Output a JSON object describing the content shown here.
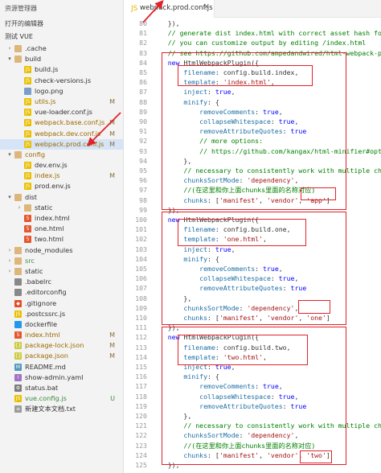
{
  "sidebar": {
    "title": "资源管理器",
    "open_editors": "打开的编辑器",
    "project": "测试 VUE",
    "items": [
      {
        "name": ".cache",
        "depth": 0,
        "kind": "folder",
        "open": false,
        "icon": "folder-icon",
        "badge": ""
      },
      {
        "name": "build",
        "depth": 0,
        "kind": "folder",
        "open": true,
        "icon": "folder-icon",
        "badge": ""
      },
      {
        "name": "build.js",
        "depth": 1,
        "kind": "js",
        "icon": "js-file-icon",
        "badge": ""
      },
      {
        "name": "check-versions.js",
        "depth": 1,
        "kind": "js",
        "icon": "js-file-icon",
        "badge": ""
      },
      {
        "name": "logo.png",
        "depth": 1,
        "kind": "image",
        "icon": "image-file-icon",
        "badge": ""
      },
      {
        "name": "utils.js",
        "depth": 1,
        "kind": "js",
        "icon": "js-file-icon",
        "badge": "M",
        "status": "modified"
      },
      {
        "name": "vue-loader.conf.js",
        "depth": 1,
        "kind": "js",
        "icon": "js-file-icon",
        "badge": ""
      },
      {
        "name": "webpack.base.conf.js",
        "depth": 1,
        "kind": "js",
        "icon": "js-file-icon",
        "badge": "M",
        "status": "modified"
      },
      {
        "name": "webpack.dev.conf.js",
        "depth": 1,
        "kind": "js",
        "icon": "js-file-icon",
        "badge": "M",
        "status": "modified"
      },
      {
        "name": "webpack.prod.conf.js",
        "depth": 1,
        "kind": "js",
        "icon": "js-file-icon",
        "badge": "M",
        "status": "modified",
        "selected": true
      },
      {
        "name": "config",
        "depth": 0,
        "kind": "folder",
        "open": true,
        "icon": "folder-icon",
        "badge": "",
        "status": "modified"
      },
      {
        "name": "dev.env.js",
        "depth": 1,
        "kind": "js",
        "icon": "js-file-icon",
        "badge": ""
      },
      {
        "name": "index.js",
        "depth": 1,
        "kind": "js",
        "icon": "js-file-icon",
        "badge": "M",
        "status": "modified"
      },
      {
        "name": "prod.env.js",
        "depth": 1,
        "kind": "js",
        "icon": "js-file-icon",
        "badge": ""
      },
      {
        "name": "dist",
        "depth": 0,
        "kind": "folder",
        "open": true,
        "icon": "folder-icon",
        "badge": ""
      },
      {
        "name": "static",
        "depth": 1,
        "kind": "folder",
        "open": false,
        "icon": "folder-icon",
        "badge": ""
      },
      {
        "name": "index.html",
        "depth": 1,
        "kind": "html",
        "icon": "html-file-icon",
        "badge": ""
      },
      {
        "name": "one.html",
        "depth": 1,
        "kind": "html",
        "icon": "html-file-icon",
        "badge": ""
      },
      {
        "name": "two.html",
        "depth": 1,
        "kind": "html",
        "icon": "html-file-icon",
        "badge": ""
      },
      {
        "name": "node_modules",
        "depth": 0,
        "kind": "folder",
        "open": false,
        "icon": "folder-icon",
        "badge": ""
      },
      {
        "name": "src",
        "depth": 0,
        "kind": "folder",
        "open": false,
        "icon": "folder-icon",
        "badge": "",
        "status": "untracked"
      },
      {
        "name": "static",
        "depth": 0,
        "kind": "folder",
        "open": false,
        "icon": "folder-icon",
        "badge": ""
      },
      {
        "name": ".babelrc",
        "depth": 0,
        "kind": "config",
        "icon": "config-file-icon",
        "badge": ""
      },
      {
        "name": ".editorconfig",
        "depth": 0,
        "kind": "config",
        "icon": "config-file-icon",
        "badge": ""
      },
      {
        "name": ".gitignore",
        "depth": 0,
        "kind": "git",
        "icon": "git-file-icon",
        "badge": ""
      },
      {
        "name": ".postcssrc.js",
        "depth": 0,
        "kind": "js",
        "icon": "js-file-icon",
        "badge": ""
      },
      {
        "name": "dockerfile",
        "depth": 0,
        "kind": "docker",
        "icon": "docker-file-icon",
        "badge": ""
      },
      {
        "name": "index.html",
        "depth": 0,
        "kind": "html",
        "icon": "html-file-icon",
        "badge": "M",
        "status": "modified"
      },
      {
        "name": "package-lock.json",
        "depth": 0,
        "kind": "json",
        "icon": "json-file-icon",
        "badge": "M",
        "status": "modified"
      },
      {
        "name": "package.json",
        "depth": 0,
        "kind": "json",
        "icon": "json-file-icon",
        "badge": "M",
        "status": "modified"
      },
      {
        "name": "README.md",
        "depth": 0,
        "kind": "md",
        "icon": "markdown-file-icon",
        "badge": ""
      },
      {
        "name": "show-admin.yaml",
        "depth": 0,
        "kind": "yaml",
        "icon": "yaml-file-icon",
        "badge": ""
      },
      {
        "name": "status.bat",
        "depth": 0,
        "kind": "bat",
        "icon": "bat-file-icon",
        "badge": ""
      },
      {
        "name": "vue.config.js",
        "depth": 0,
        "kind": "js",
        "icon": "js-file-icon",
        "badge": "U",
        "status": "untracked"
      },
      {
        "name": "新建文本文档.txt",
        "depth": 0,
        "kind": "txt",
        "icon": "text-file-icon",
        "badge": ""
      }
    ]
  },
  "tab": {
    "label": "webpack.prod.conf.js",
    "close": "×"
  },
  "editor": {
    "first_line": 80,
    "lines": [
      [
        [
          "n",
          "    }),"
        ]
      ],
      [
        [
          "c",
          "    // generate dist index.html with correct asset hash fo"
        ]
      ],
      [
        [
          "c",
          "    // you can customize output by editing /index.html"
        ]
      ],
      [
        [
          "c",
          "    // see https://github.com/ampedandwired/html-webpack-p"
        ]
      ],
      [
        [
          "k",
          "    new "
        ],
        [
          "n",
          "HtmlWebpackPlugin({"
        ]
      ],
      [
        [
          "p",
          "        filename"
        ],
        [
          "n",
          ": config.build.index,"
        ]
      ],
      [
        [
          "p",
          "        template"
        ],
        [
          "n",
          ": "
        ],
        [
          "s",
          "'index.html'"
        ],
        [
          "n",
          ","
        ]
      ],
      [
        [
          "p",
          "        inject"
        ],
        [
          "n",
          ": "
        ],
        [
          "k",
          "true"
        ],
        [
          "n",
          ","
        ]
      ],
      [
        [
          "p",
          "        minify"
        ],
        [
          "n",
          ": {"
        ]
      ],
      [
        [
          "p",
          "            removeComments"
        ],
        [
          "n",
          ": "
        ],
        [
          "k",
          "true"
        ],
        [
          "n",
          ","
        ]
      ],
      [
        [
          "p",
          "            collapseWhitespace"
        ],
        [
          "n",
          ": "
        ],
        [
          "k",
          "true"
        ],
        [
          "n",
          ","
        ]
      ],
      [
        [
          "p",
          "            removeAttributeQuotes"
        ],
        [
          "n",
          ": "
        ],
        [
          "k",
          "true"
        ]
      ],
      [
        [
          "c",
          "            // more options:"
        ]
      ],
      [
        [
          "c",
          "            // https://github.com/kangax/html-minifier#opt"
        ]
      ],
      [
        [
          "n",
          "        },"
        ]
      ],
      [
        [
          "c",
          "        // necessary to consistently work with multiple ch"
        ]
      ],
      [
        [
          "p",
          "        chunksSortMode"
        ],
        [
          "n",
          ": "
        ],
        [
          "s",
          "'dependency'"
        ],
        [
          "n",
          ","
        ]
      ],
      [
        [
          "c",
          "        //(在这里和你上面chunks里面的名称对应)"
        ]
      ],
      [
        [
          "p",
          "        chunks"
        ],
        [
          "n",
          ": ["
        ],
        [
          "s",
          "'manifest'"
        ],
        [
          "n",
          ", "
        ],
        [
          "s",
          "'vendor'"
        ],
        [
          "n",
          ", "
        ],
        [
          "s",
          "'app'"
        ],
        [
          "n",
          "]"
        ]
      ],
      [
        [
          "n",
          "    }),"
        ]
      ],
      [
        [
          "k",
          "    new "
        ],
        [
          "n",
          "HtmlWebpackPlugin({"
        ]
      ],
      [
        [
          "p",
          "        filename"
        ],
        [
          "n",
          ": config.build.one,"
        ]
      ],
      [
        [
          "p",
          "        template"
        ],
        [
          "n",
          ": "
        ],
        [
          "s",
          "'one.html'"
        ],
        [
          "n",
          ","
        ]
      ],
      [
        [
          "p",
          "        inject"
        ],
        [
          "n",
          ": "
        ],
        [
          "k",
          "true"
        ],
        [
          "n",
          ","
        ]
      ],
      [
        [
          "p",
          "        minify"
        ],
        [
          "n",
          ": {"
        ]
      ],
      [
        [
          "p",
          "            removeComments"
        ],
        [
          "n",
          ": "
        ],
        [
          "k",
          "true"
        ],
        [
          "n",
          ","
        ]
      ],
      [
        [
          "p",
          "            collapseWhitespace"
        ],
        [
          "n",
          ": "
        ],
        [
          "k",
          "true"
        ],
        [
          "n",
          ","
        ]
      ],
      [
        [
          "p",
          "            removeAttributeQuotes"
        ],
        [
          "n",
          ": "
        ],
        [
          "k",
          "true"
        ]
      ],
      [
        [
          "n",
          "        },"
        ]
      ],
      [
        [
          "p",
          "        chunksSortMode"
        ],
        [
          "n",
          ": "
        ],
        [
          "s",
          "'dependency'"
        ],
        [
          "n",
          ","
        ]
      ],
      [
        [
          "p",
          "        chunks"
        ],
        [
          "n",
          ": ["
        ],
        [
          "s",
          "'manifest'"
        ],
        [
          "n",
          ", "
        ],
        [
          "s",
          "'vendor'"
        ],
        [
          "n",
          ", "
        ],
        [
          "s",
          "'one'"
        ],
        [
          "n",
          "]"
        ]
      ],
      [
        [
          "n",
          "    }),"
        ]
      ],
      [
        [
          "k",
          "    new "
        ],
        [
          "n",
          "HtmlWebpackPlugin({"
        ]
      ],
      [
        [
          "p",
          "        filename"
        ],
        [
          "n",
          ": config.build.two,"
        ]
      ],
      [
        [
          "p",
          "        template"
        ],
        [
          "n",
          ": "
        ],
        [
          "s",
          "'two.html'"
        ],
        [
          "n",
          ","
        ]
      ],
      [
        [
          "p",
          "        inject"
        ],
        [
          "n",
          ": "
        ],
        [
          "k",
          "true"
        ],
        [
          "n",
          ","
        ]
      ],
      [
        [
          "p",
          "        minify"
        ],
        [
          "n",
          ": {"
        ]
      ],
      [
        [
          "p",
          "            removeComments"
        ],
        [
          "n",
          ": "
        ],
        [
          "k",
          "true"
        ],
        [
          "n",
          ","
        ]
      ],
      [
        [
          "p",
          "            collapseWhitespace"
        ],
        [
          "n",
          ": "
        ],
        [
          "k",
          "true"
        ],
        [
          "n",
          ","
        ]
      ],
      [
        [
          "p",
          "            removeAttributeQuotes"
        ],
        [
          "n",
          ": "
        ],
        [
          "k",
          "true"
        ]
      ],
      [
        [
          "n",
          "        },"
        ]
      ],
      [
        [
          "c",
          "        // necessary to consistently work with multiple ch"
        ]
      ],
      [
        [
          "p",
          "        chunksSortMode"
        ],
        [
          "n",
          ": "
        ],
        [
          "s",
          "'dependency'"
        ],
        [
          "n",
          ","
        ]
      ],
      [
        [
          "c",
          "        //(在这里和你上面chunks里面的名称对应)"
        ]
      ],
      [
        [
          "p",
          "        chunks"
        ],
        [
          "n",
          ": ["
        ],
        [
          "s",
          "'manifest'"
        ],
        [
          "n",
          ", "
        ],
        [
          "s",
          "'vendor'"
        ],
        [
          "n",
          ", "
        ],
        [
          "s",
          "'two'"
        ],
        [
          "n",
          "]"
        ]
      ],
      [
        [
          "n",
          "    }),"
        ]
      ]
    ]
  },
  "colors": {
    "annotation": "#e0232a",
    "selected": "#d6e4f7",
    "modified": "#9c6a00",
    "untracked": "#3e8a3e"
  }
}
